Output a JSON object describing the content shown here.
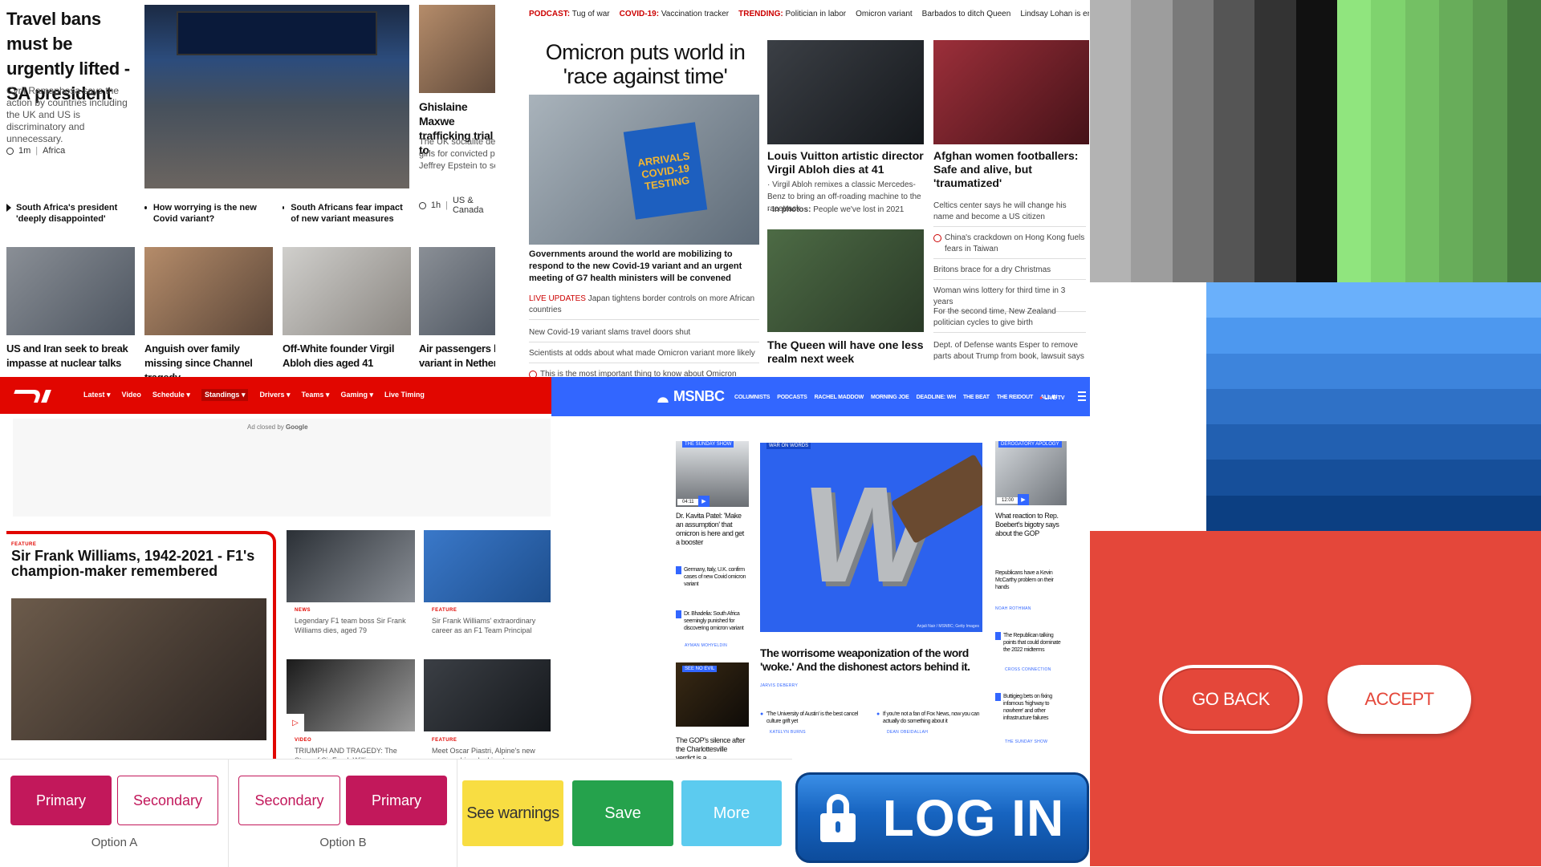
{
  "bbc": {
    "lead_title": "Travel bans must be urgently lifted - SA president",
    "lead_summary": "Cyril Ramaphosa says the action by countries including the UK and US is discriminatory and unnecessary.",
    "lead_time": "1m",
    "lead_section": "Africa",
    "maxwell_title": "Ghislaine Maxwe trafficking trial to",
    "maxwell_summary": "The UK socialite den girls for convicted pa Jeffrey Epstein to se",
    "maxwell_time": "1h",
    "maxwell_section": "US & Canada",
    "bullets": [
      "South Africa's president 'deeply disappointed'",
      "How worrying is the new Covid variant?",
      "South Africans fear impact of new variant measures"
    ],
    "row2": [
      "US and Iran seek to break impasse at nuclear talks",
      "Anguish over family missing since Channel tragedy",
      "Off-White founder Virgil Abloh dies aged 41",
      "Air passengers h variant in Nether"
    ]
  },
  "cnn": {
    "topbar": [
      {
        "label": "PODCAST:",
        "text": "Tug of war"
      },
      {
        "label": "COVID-19:",
        "text": "Vaccination tracker"
      },
      {
        "label": "TRENDING:",
        "text": "Politician in labor"
      },
      {
        "label": "",
        "text": "Omicron variant"
      },
      {
        "label": "",
        "text": "Barbados to ditch Queen"
      },
      {
        "label": "",
        "text": "Lindsay Lohan is engaged"
      }
    ],
    "headline": "Omicron puts world in 'race against time'",
    "sign_text": "ARRIVALS COVID-19 TESTING",
    "lead_caption": "Governments around the world are mobilizing to respond to the new Covid-19 variant and an urgent meeting of G7 health ministers will be convened",
    "live_label": "LIVE UPDATES",
    "live_text": "Japan tightens border controls on more African countries",
    "list": [
      "New Covid-19 variant slams travel doors shut",
      "Scientists at odds about what made Omicron variant more likely",
      "This is the most important thing to know about Omicron"
    ],
    "col2_title": "Louis Vuitton artistic director Virgil Abloh dies at 41",
    "col2_sub1": "Virgil Abloh remixes a classic Mercedes-Benz to bring an off-roading machine to the racetrack",
    "col2_sub2_label": "In photos:",
    "col2_sub2": "People we've lost in 2021",
    "col2_title2": "The Queen will have one less realm next week",
    "col3_title": "Afghan women footballers: Safe and alive, but 'traumatized'",
    "col3_list": [
      "Celtics center says he will change his name and become a US citizen",
      "China's crackdown on Hong Kong fuels fears in Taiwan",
      "Britons brace for a dry Christmas",
      "Woman wins lottery for third time in 3 years",
      "For the second time, New Zealand politician cycles to give birth",
      "Dept. of Defense wants Esper to remove parts about Trump from book, lawsuit says"
    ]
  },
  "f1": {
    "nav": [
      "Latest",
      "Video",
      "Schedule",
      "Standings",
      "Drivers",
      "Teams",
      "Gaming",
      "Live Timing"
    ],
    "ad_text": "Ad closed by",
    "ad_brand": "Google",
    "feature_tag": "FEATURE",
    "feature_title": "Sir Frank Williams, 1942-2021 - F1's champion-maker remembered",
    "cards": [
      {
        "tag": "NEWS",
        "text": "Legendary F1 team boss Sir Frank Williams dies, aged 79"
      },
      {
        "tag": "FEATURE",
        "text": "Sir Frank Williams' extraordinary career as an F1 Team Principal"
      },
      {
        "tag": "VIDEO",
        "text": "TRIUMPH AND TRAGEDY: The Story of Sir Frank Williams"
      },
      {
        "tag": "FEATURE",
        "text": "Meet Oscar Piastri, Alpine's new reserve driver looking to go one"
      }
    ]
  },
  "msnbc": {
    "logo": "MSNBC",
    "nav": [
      "COLUMNISTS",
      "PODCASTS",
      "RACHEL MADDOW",
      "MORNING JOE",
      "DEADLINE: WH",
      "THE BEAT",
      "THE REIDOUT",
      "ALL IN"
    ],
    "live": "LIVE TV",
    "left_tag": "THE SUNDAY SHOW",
    "left_duration": "04:11",
    "left_title": "Dr. Kavita Patel: 'Make an assumption' that omicron is here and get a booster",
    "left_list": [
      "Germany, Italy, U.K. confirm cases of new Covid omicron variant",
      "Dr. Bhadelia: South Africa seemingly punished for discovering omicron variant"
    ],
    "left_list_author": "AYMAN MOHYELDIN",
    "left_tag2": "SEE NO EVIL",
    "left_title2": "The GOP's silence after the Charlottesville verdict is a",
    "center_tag": "WAR ON WORDS",
    "center_credit": "Anjali Nair / MSNBC; Getty Images",
    "center_title": "The worrisome weaponization of the word 'woke.' And the dishonest actors behind it.",
    "center_author": "JARVIS DEBERRY",
    "center_sub1": "'The University of Austin' is the best cancel culture grift yet",
    "center_sub1_author": "KATELYN BURNS",
    "center_sub2": "If you're not a fan of Fox News, now you can actually do something about it",
    "center_sub2_author": "DEAN OBEIDALLAH",
    "right_tag": "DEROGATORY APOLOGY",
    "right_duration": "12:00",
    "right_title": "What reaction to Rep. Boebert's bigotry says about the GOP",
    "right_list": [
      {
        "text": "Republicans have a Kevin McCarthy problem on their hands",
        "author": "NOAH ROTHMAN"
      },
      {
        "text": "The Republican talking points that could dominate the 2022 midterms",
        "author": "CROSS CONNECTION"
      },
      {
        "text": "Buttigieg bets on fixing infamous 'highway to nowhere' and other infrastructure failures",
        "author": "THE SUNDAY SHOW"
      }
    ]
  },
  "buttons": {
    "option_a": {
      "primary": "Primary",
      "secondary": "Secondary",
      "label": "Option A"
    },
    "option_b": {
      "secondary": "Secondary",
      "primary": "Primary",
      "label": "Option B"
    },
    "warnings": "See warnings",
    "save": "Save",
    "more": "More",
    "login": "LOG IN",
    "go_back": "GO BACK",
    "accept": "ACCEPT"
  },
  "palettes": {
    "grays": [
      "#b3b3b3",
      "#9d9d9d",
      "#7a7a7a",
      "#555555",
      "#333333",
      "#111111",
      "#000000"
    ],
    "greens": [
      "#90e57e",
      "#7fd36e",
      "#74c064",
      "#68ad5a",
      "#5c9a50",
      "#508947",
      "#467a3e"
    ],
    "blues": [
      "#6ab0fb",
      "#4d98ef",
      "#3d84dc",
      "#2f71c6",
      "#2260b1",
      "#164f9a",
      "#0c3f82"
    ],
    "red_panel": "#e4473a"
  }
}
